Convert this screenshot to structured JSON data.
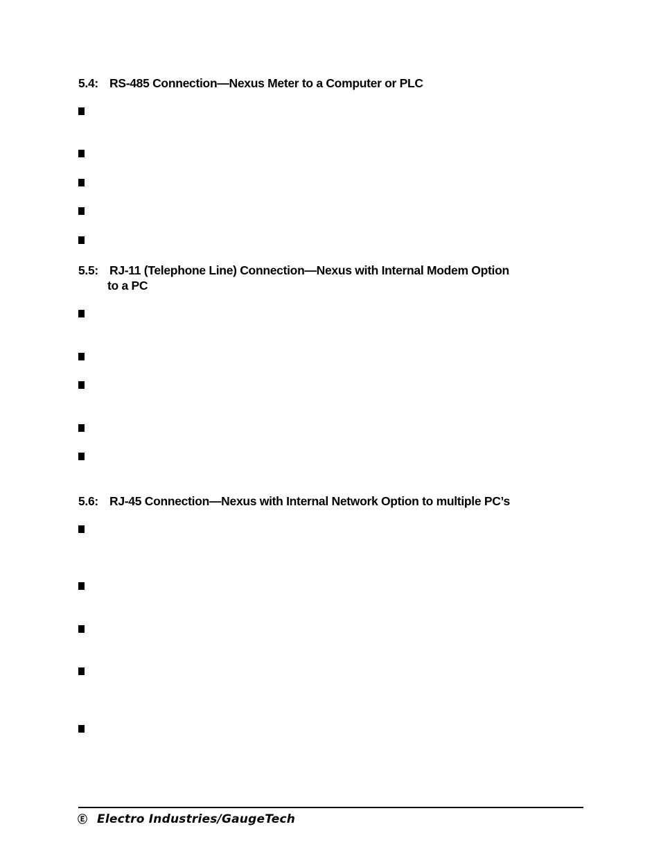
{
  "sections": [
    {
      "number": "5.4:",
      "title": "RS-485 Connection—Nexus Meter to a Computer or PLC",
      "title_cont": "",
      "bullet_count": 5
    },
    {
      "number": "5.5:",
      "title": "RJ-11 (Telephone Line) Connection—Nexus with Internal Modem Option",
      "title_cont": "to a PC",
      "bullet_count": 5
    },
    {
      "number": "5.6:",
      "title": "RJ-45 Connection—Nexus with Internal Network Option to multiple PC’s",
      "title_cont": "",
      "bullet_count": 5
    }
  ],
  "footer": {
    "logo_text": "Ⓔ",
    "company": "Electro Industries/GaugeTech"
  }
}
